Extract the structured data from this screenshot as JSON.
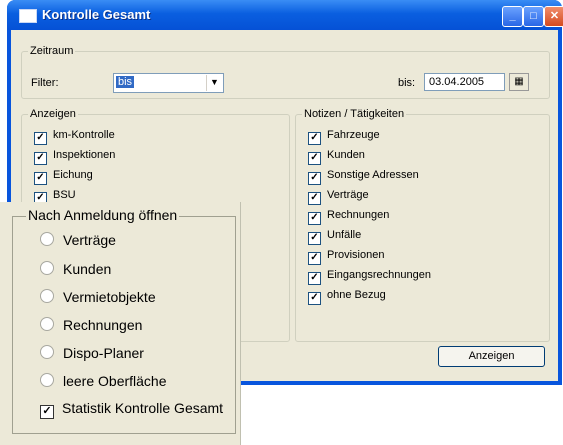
{
  "window": {
    "title": "Kontrolle Gesamt",
    "controls": {
      "minimize": "_",
      "maximize": "□",
      "close": "✕"
    }
  },
  "zeitraum": {
    "legend": "Zeitraum",
    "filter_label": "Filter:",
    "filter_value": "bis",
    "bis_label": "bis:",
    "bis_value": "03.04.2005",
    "calendar_icon": "calendar-icon"
  },
  "anzeigen": {
    "legend": "Anzeigen",
    "items": [
      {
        "label": "km-Kontrolle",
        "checked": true
      },
      {
        "label": "Inspektionen",
        "checked": true
      },
      {
        "label": "Eichung",
        "checked": true
      },
      {
        "label": "BSU",
        "checked": true
      }
    ]
  },
  "notizen": {
    "legend": "Notizen / Tätigkeiten",
    "items": [
      {
        "label": "Fahrzeuge",
        "checked": true
      },
      {
        "label": "Kunden",
        "checked": true
      },
      {
        "label": "Sonstige Adressen",
        "checked": true
      },
      {
        "label": "Verträge",
        "checked": true
      },
      {
        "label": "Rechnungen",
        "checked": true
      },
      {
        "label": "Unfälle",
        "checked": true
      },
      {
        "label": "Provisionen",
        "checked": true
      },
      {
        "label": "Eingangsrechnungen",
        "checked": true
      },
      {
        "label": "ohne Bezug",
        "checked": true
      }
    ]
  },
  "anzeigen_button": "Anzeigen",
  "overlay": {
    "legend": "Nach Anmeldung öffnen",
    "options": [
      {
        "label": "Verträge",
        "kind": "radio"
      },
      {
        "label": "Kunden",
        "kind": "radio"
      },
      {
        "label": "Vermietobjekte",
        "kind": "radio"
      },
      {
        "label": "Rechnungen",
        "kind": "radio"
      },
      {
        "label": "Dispo-Planer",
        "kind": "radio"
      },
      {
        "label": "leere Oberfläche",
        "kind": "radio"
      },
      {
        "label": "Statistik Kontrolle Gesamt",
        "kind": "checkbox",
        "checked": true
      }
    ]
  }
}
